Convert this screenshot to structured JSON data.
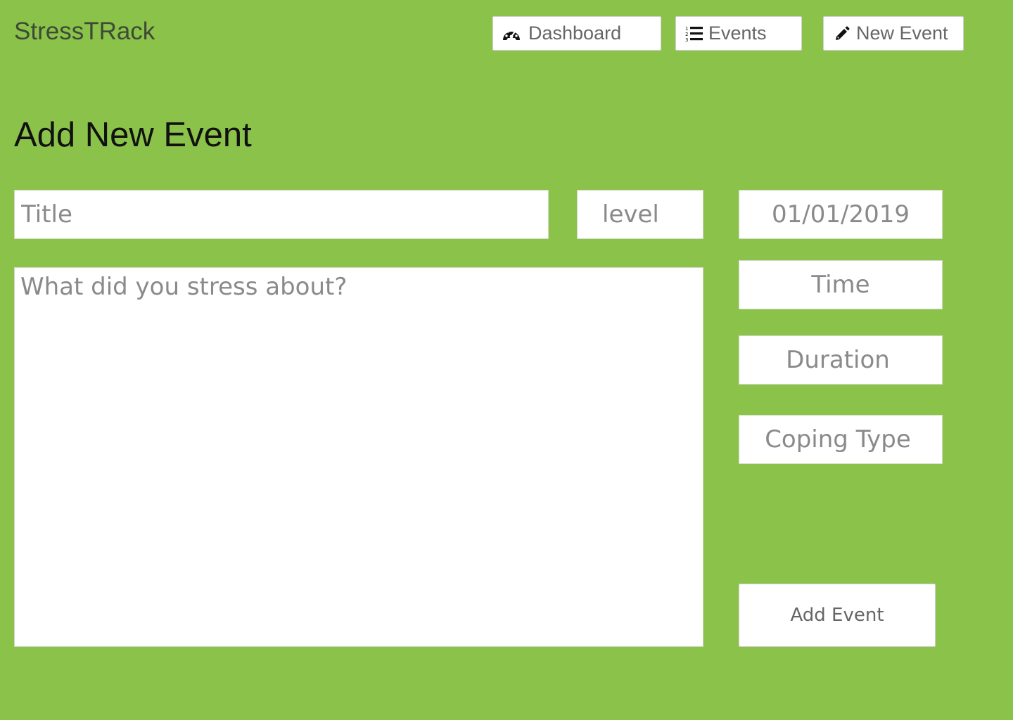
{
  "app": {
    "brand": "StressTRack"
  },
  "nav": {
    "items": [
      {
        "label": "Dashboard",
        "icon": "dashboard-gauge-icon"
      },
      {
        "label": "Events",
        "icon": "ordered-list-icon"
      },
      {
        "label": "New Event",
        "icon": "pencil-icon"
      }
    ]
  },
  "page": {
    "title": "Add New Event"
  },
  "form": {
    "title_placeholder": "Title",
    "level_placeholder": "level",
    "date_placeholder": "01/01/2019",
    "time_placeholder": "Time",
    "duration_placeholder": "Duration",
    "coping_placeholder": "Coping Type",
    "description_placeholder": "What did you stress about?",
    "submit_label": "Add Event"
  },
  "colors": {
    "background": "#8bc34a",
    "surface": "#ffffff",
    "placeholder_text": "#8a8a8a"
  }
}
